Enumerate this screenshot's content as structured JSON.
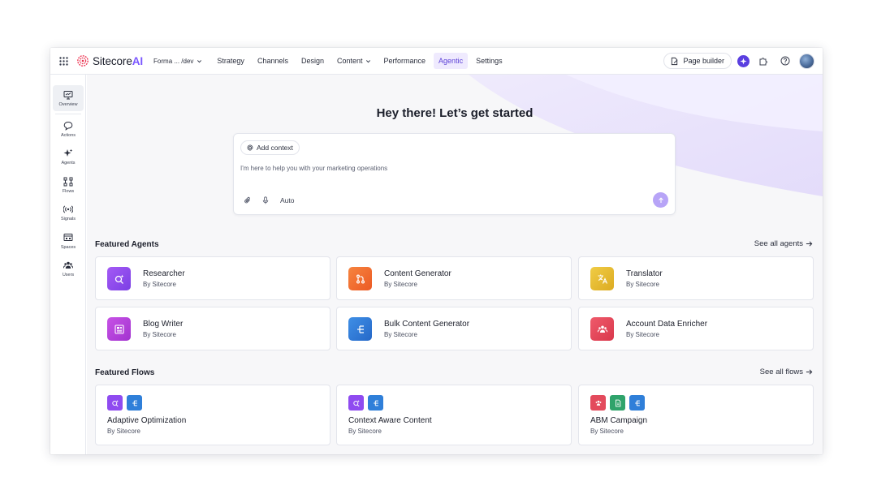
{
  "app": {
    "logo_brand": "Sitecore",
    "logo_suffix": "AI",
    "workspace": "Forma ... /dev"
  },
  "nav": {
    "items": [
      {
        "label": "Strategy"
      },
      {
        "label": "Channels"
      },
      {
        "label": "Design"
      },
      {
        "label": "Content"
      },
      {
        "label": "Performance"
      },
      {
        "label": "Agentic"
      },
      {
        "label": "Settings"
      }
    ],
    "active": "Agentic"
  },
  "topbar": {
    "page_builder_label": "Page builder"
  },
  "sidebar": {
    "items": [
      {
        "label": "Overview",
        "icon": "monitor-icon"
      },
      {
        "label": "Actions",
        "icon": "chat-icon"
      },
      {
        "label": "Agents",
        "icon": "sparkles-icon"
      },
      {
        "label": "Flows",
        "icon": "flows-icon"
      },
      {
        "label": "Signals",
        "icon": "signal-icon"
      },
      {
        "label": "Spaces",
        "icon": "spaces-icon"
      },
      {
        "label": "Users",
        "icon": "users-icon"
      }
    ]
  },
  "hero": {
    "title": "Hey there! Let’s get started"
  },
  "composer": {
    "add_context_label": "Add context",
    "placeholder": "I'm here to help you with your marketing operations",
    "mode_label": "Auto"
  },
  "featured_agents": {
    "title": "Featured Agents",
    "see_all_label": "See all agents",
    "items": [
      {
        "title": "Researcher",
        "subtitle": "By Sitecore",
        "icon": "search-spark-icon",
        "color": "#8f4bf0"
      },
      {
        "title": "Content Generator",
        "subtitle": "By Sitecore",
        "icon": "branch-icon",
        "color": "#f06a2c"
      },
      {
        "title": "Translator",
        "subtitle": "By Sitecore",
        "icon": "translate-icon",
        "color": "#e2b92d"
      },
      {
        "title": "Blog Writer",
        "subtitle": "By Sitecore",
        "icon": "article-icon",
        "color": "#b73fd6"
      },
      {
        "title": "Bulk Content Generator",
        "subtitle": "By Sitecore",
        "icon": "hierarchy-icon",
        "color": "#2f7fd9"
      },
      {
        "title": "Account Data Enricher",
        "subtitle": "By Sitecore",
        "icon": "people-icon",
        "color": "#e34a5c"
      }
    ]
  },
  "featured_flows": {
    "title": "Featured Flows",
    "see_all_label": "See all flows",
    "items": [
      {
        "title": "Adaptive Optimization",
        "subtitle": "By Sitecore",
        "icons": [
          {
            "name": "search-spark-icon",
            "color": "#8f4bf0"
          },
          {
            "name": "hierarchy-icon",
            "color": "#2f7fd9"
          }
        ]
      },
      {
        "title": "Context Aware Content",
        "subtitle": "By Sitecore",
        "icons": [
          {
            "name": "search-spark-icon",
            "color": "#8f4bf0"
          },
          {
            "name": "hierarchy-icon",
            "color": "#2f7fd9"
          }
        ]
      },
      {
        "title": "ABM Campaign",
        "subtitle": "By Sitecore",
        "icons": [
          {
            "name": "people-icon",
            "color": "#e34a5c"
          },
          {
            "name": "document-icon",
            "color": "#2fa36b"
          },
          {
            "name": "hierarchy-icon",
            "color": "#2f7fd9"
          }
        ]
      }
    ]
  },
  "colors": {
    "accent": "#5a3fe0",
    "active_nav_bg": "#efeafe",
    "send_button": "#b7a4f7"
  }
}
